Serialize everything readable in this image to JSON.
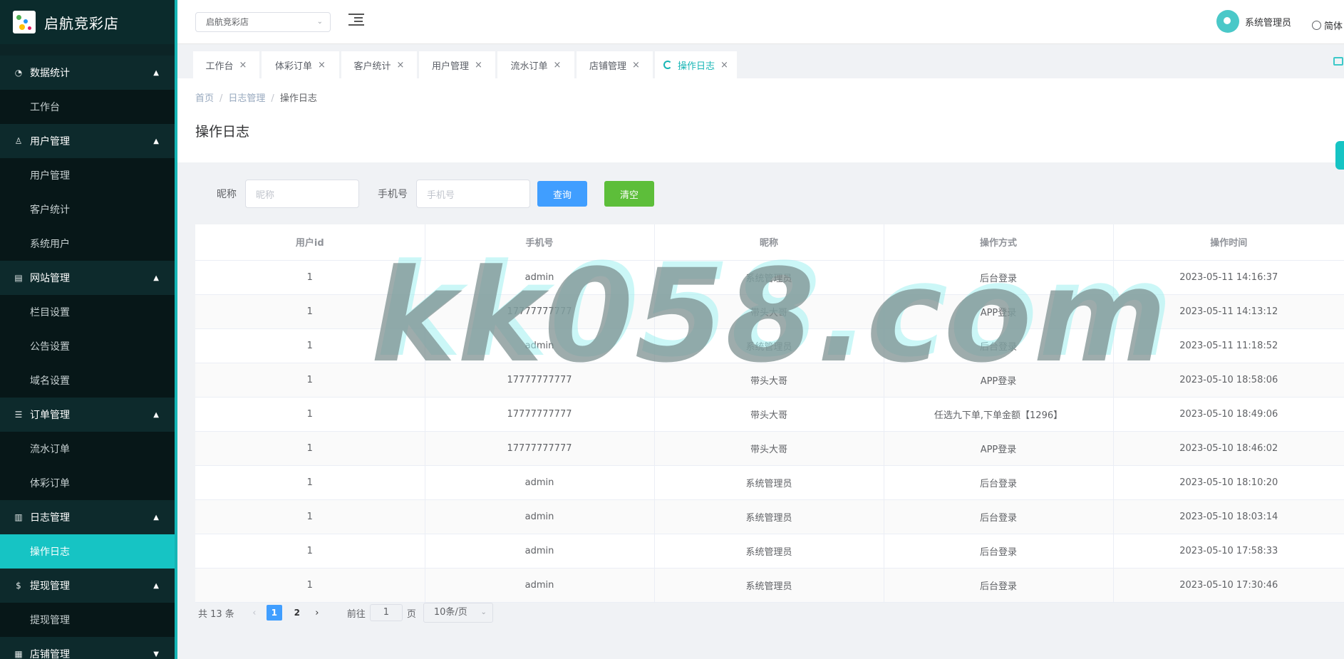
{
  "brand": {
    "title": "启航竞彩店"
  },
  "sidebar": {
    "groups": [
      {
        "label": "数据统计",
        "icon": "dashboard-icon",
        "items": [
          "工作台"
        ]
      },
      {
        "label": "用户管理",
        "icon": "user-icon",
        "items": [
          "用户管理",
          "客户统计",
          "系统用户"
        ]
      },
      {
        "label": "网站管理",
        "icon": "document-icon",
        "items": [
          "栏目设置",
          "公告设置",
          "域名设置"
        ]
      },
      {
        "label": "订单管理",
        "icon": "list-icon",
        "items": [
          "流水订单",
          "体彩订单"
        ]
      },
      {
        "label": "日志管理",
        "icon": "book-icon",
        "items": [
          "操作日志"
        ]
      },
      {
        "label": "提现管理",
        "icon": "dollar-icon",
        "items": [
          "提现管理"
        ]
      },
      {
        "label": "店铺管理",
        "icon": "shop-icon",
        "items": []
      }
    ],
    "active_item": "操作日志"
  },
  "header": {
    "shop_select": "启航竞彩店",
    "user_name": "系统管理员",
    "lang": "简体"
  },
  "tabs": [
    {
      "label": "工作台"
    },
    {
      "label": "体彩订单"
    },
    {
      "label": "客户统计"
    },
    {
      "label": "用户管理"
    },
    {
      "label": "流水订单"
    },
    {
      "label": "店铺管理"
    },
    {
      "label": "操作日志",
      "active": true
    }
  ],
  "breadcrumb": {
    "home": "首页",
    "section": "日志管理",
    "current": "操作日志"
  },
  "page_title": "操作日志",
  "filter": {
    "nickname_label": "昵称",
    "nickname_placeholder": "昵称",
    "phone_label": "手机号",
    "phone_placeholder": "手机号",
    "query_button": "查询",
    "clear_button": "清空"
  },
  "table": {
    "columns": [
      "用户id",
      "手机号",
      "昵称",
      "操作方式",
      "操作时间"
    ],
    "rows": [
      [
        "1",
        "admin",
        "系统管理员",
        "后台登录",
        "2023-05-11 14:16:37"
      ],
      [
        "1",
        "17777777777",
        "带头大哥",
        "APP登录",
        "2023-05-11 14:13:12"
      ],
      [
        "1",
        "admin",
        "系统管理员",
        "后台登录",
        "2023-05-11 11:18:52"
      ],
      [
        "1",
        "17777777777",
        "带头大哥",
        "APP登录",
        "2023-05-10 18:58:06"
      ],
      [
        "1",
        "17777777777",
        "带头大哥",
        "任选九下单,下单金额【1296】",
        "2023-05-10 18:49:06"
      ],
      [
        "1",
        "17777777777",
        "带头大哥",
        "APP登录",
        "2023-05-10 18:46:02"
      ],
      [
        "1",
        "admin",
        "系统管理员",
        "后台登录",
        "2023-05-10 18:10:20"
      ],
      [
        "1",
        "admin",
        "系统管理员",
        "后台登录",
        "2023-05-10 18:03:14"
      ],
      [
        "1",
        "admin",
        "系统管理员",
        "后台登录",
        "2023-05-10 17:58:33"
      ],
      [
        "1",
        "admin",
        "系统管理员",
        "后台登录",
        "2023-05-10 17:30:46"
      ]
    ]
  },
  "pager": {
    "total": "共 13 条",
    "pages": [
      "1",
      "2"
    ],
    "current_page": "1",
    "goto_label": "前往",
    "goto_value": "1",
    "page_suffix": "页",
    "page_size": "10条/页"
  },
  "watermark": "kk058.com",
  "colors": {
    "accent": "#16c4c4",
    "primary": "#409eff",
    "success": "#5dbe3a",
    "sidebar_bg": "#0c2426"
  }
}
